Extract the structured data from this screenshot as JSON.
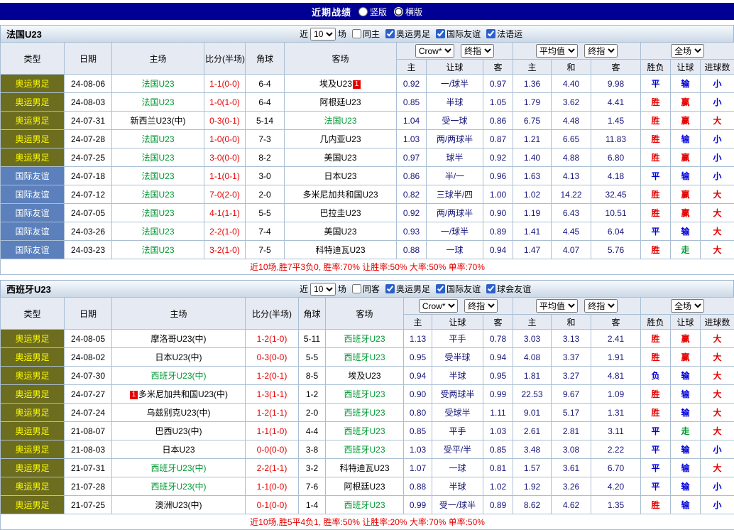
{
  "topbar": {
    "title": "近期战绩",
    "radios": [
      {
        "label": "竖版",
        "selected": false
      },
      {
        "label": "横版",
        "selected": true
      }
    ]
  },
  "table_headers": {
    "type": "类型",
    "date": "日期",
    "home": "主场",
    "score": "比分(半场)",
    "corner": "角球",
    "away": "客场",
    "sub": [
      "主",
      "让球",
      "客",
      "主",
      "和",
      "客",
      "胜负",
      "让球",
      "进球数"
    ],
    "dd_crow": "Crow*",
    "dd_final": "终指",
    "dd_avg": "平均值",
    "dd_full": "全场"
  },
  "sections": [
    {
      "team": "法国U23",
      "filter": {
        "near": "近",
        "count": "10",
        "games": "场",
        "same": "同主",
        "leagues": [
          "奥运男足",
          "国际友谊",
          "法语运"
        ]
      },
      "rows": [
        {
          "type": "奥运男足",
          "tclass": "olympic",
          "date": "24-08-06",
          "home": "法国U23",
          "hgreen": true,
          "score": "1-1(0-0)",
          "corner": "6-4",
          "away": "埃及U23",
          "abadge": "1",
          "asian": [
            "0.92",
            "一/球半",
            "0.97"
          ],
          "euro": [
            "1.36",
            "4.40",
            "9.98"
          ],
          "res": [
            [
              "平",
              "b"
            ],
            [
              "输",
              "b"
            ],
            [
              "小",
              "b"
            ]
          ]
        },
        {
          "type": "奥运男足",
          "tclass": "olympic",
          "date": "24-08-03",
          "home": "法国U23",
          "hgreen": true,
          "score": "1-0(1-0)",
          "corner": "6-4",
          "away": "阿根廷U23",
          "asian": [
            "0.85",
            "半球",
            "1.05"
          ],
          "euro": [
            "1.79",
            "3.62",
            "4.41"
          ],
          "res": [
            [
              "胜",
              "r"
            ],
            [
              "赢",
              "r"
            ],
            [
              "小",
              "b"
            ]
          ]
        },
        {
          "type": "奥运男足",
          "tclass": "olympic",
          "date": "24-07-31",
          "home": "新西兰U23(中)",
          "score": "0-3(0-1)",
          "corner": "5-14",
          "away": "法国U23",
          "agreen": true,
          "asian": [
            "1.04",
            "受一球",
            "0.86"
          ],
          "euro": [
            "6.75",
            "4.48",
            "1.45"
          ],
          "res": [
            [
              "胜",
              "r"
            ],
            [
              "赢",
              "r"
            ],
            [
              "大",
              "r"
            ]
          ]
        },
        {
          "type": "奥运男足",
          "tclass": "olympic",
          "date": "24-07-28",
          "home": "法国U23",
          "hgreen": true,
          "score": "1-0(0-0)",
          "corner": "7-3",
          "away": "几内亚U23",
          "asian": [
            "1.03",
            "两/两球半",
            "0.87"
          ],
          "euro": [
            "1.21",
            "6.65",
            "11.83"
          ],
          "res": [
            [
              "胜",
              "r"
            ],
            [
              "输",
              "b"
            ],
            [
              "小",
              "b"
            ]
          ]
        },
        {
          "type": "奥运男足",
          "tclass": "olympic",
          "date": "24-07-25",
          "home": "法国U23",
          "hgreen": true,
          "score": "3-0(0-0)",
          "corner": "8-2",
          "away": "美国U23",
          "asian": [
            "0.97",
            "球半",
            "0.92"
          ],
          "euro": [
            "1.40",
            "4.88",
            "6.80"
          ],
          "res": [
            [
              "胜",
              "r"
            ],
            [
              "赢",
              "r"
            ],
            [
              "小",
              "b"
            ]
          ]
        },
        {
          "type": "国际友谊",
          "tclass": "friendly",
          "date": "24-07-18",
          "home": "法国U23",
          "hgreen": true,
          "score": "1-1(0-1)",
          "corner": "3-0",
          "away": "日本U23",
          "asian": [
            "0.86",
            "半/一",
            "0.96"
          ],
          "euro": [
            "1.63",
            "4.13",
            "4.18"
          ],
          "res": [
            [
              "平",
              "b"
            ],
            [
              "输",
              "b"
            ],
            [
              "小",
              "b"
            ]
          ]
        },
        {
          "type": "国际友谊",
          "tclass": "friendly",
          "date": "24-07-12",
          "home": "法国U23",
          "hgreen": true,
          "score": "7-0(2-0)",
          "corner": "2-0",
          "away": "多米尼加共和国U23",
          "asian": [
            "0.82",
            "三球半/四",
            "1.00"
          ],
          "euro": [
            "1.02",
            "14.22",
            "32.45"
          ],
          "res": [
            [
              "胜",
              "r"
            ],
            [
              "赢",
              "r"
            ],
            [
              "大",
              "r"
            ]
          ]
        },
        {
          "type": "国际友谊",
          "tclass": "friendly",
          "date": "24-07-05",
          "home": "法国U23",
          "hgreen": true,
          "score": "4-1(1-1)",
          "corner": "5-5",
          "away": "巴拉圭U23",
          "asian": [
            "0.92",
            "两/两球半",
            "0.90"
          ],
          "euro": [
            "1.19",
            "6.43",
            "10.51"
          ],
          "res": [
            [
              "胜",
              "r"
            ],
            [
              "赢",
              "r"
            ],
            [
              "大",
              "r"
            ]
          ]
        },
        {
          "type": "国际友谊",
          "tclass": "friendly",
          "date": "24-03-26",
          "home": "法国U23",
          "hgreen": true,
          "score": "2-2(1-0)",
          "corner": "7-4",
          "away": "美国U23",
          "asian": [
            "0.93",
            "一/球半",
            "0.89"
          ],
          "euro": [
            "1.41",
            "4.45",
            "6.04"
          ],
          "res": [
            [
              "平",
              "b"
            ],
            [
              "输",
              "b"
            ],
            [
              "大",
              "r"
            ]
          ]
        },
        {
          "type": "国际友谊",
          "tclass": "friendly",
          "date": "24-03-23",
          "home": "法国U23",
          "hgreen": true,
          "score": "3-2(1-0)",
          "corner": "7-5",
          "away": "科特迪瓦U23",
          "asian": [
            "0.88",
            "一球",
            "0.94"
          ],
          "euro": [
            "1.47",
            "4.07",
            "5.76"
          ],
          "res": [
            [
              "胜",
              "r"
            ],
            [
              "走",
              "g"
            ],
            [
              "大",
              "r"
            ]
          ]
        }
      ],
      "footer": "近10场,胜7平3负0, 胜率:70% 让胜率:50% 大率:50% 单率:70%"
    },
    {
      "team": "西班牙U23",
      "filter": {
        "near": "近",
        "count": "10",
        "games": "场",
        "same": "同客",
        "leagues": [
          "奥运男足",
          "国际友谊",
          "球会友谊"
        ]
      },
      "rows": [
        {
          "type": "奥运男足",
          "tclass": "olympic",
          "date": "24-08-05",
          "home": "摩洛哥U23(中)",
          "score": "1-2(1-0)",
          "corner": "5-11",
          "away": "西班牙U23",
          "agreen": true,
          "asian": [
            "1.13",
            "平手",
            "0.78"
          ],
          "euro": [
            "3.03",
            "3.13",
            "2.41"
          ],
          "res": [
            [
              "胜",
              "r"
            ],
            [
              "赢",
              "r"
            ],
            [
              "大",
              "r"
            ]
          ]
        },
        {
          "type": "奥运男足",
          "tclass": "olympic",
          "date": "24-08-02",
          "home": "日本U23(中)",
          "score": "0-3(0-0)",
          "corner": "5-5",
          "away": "西班牙U23",
          "agreen": true,
          "asian": [
            "0.95",
            "受半球",
            "0.94"
          ],
          "euro": [
            "4.08",
            "3.37",
            "1.91"
          ],
          "res": [
            [
              "胜",
              "r"
            ],
            [
              "赢",
              "r"
            ],
            [
              "大",
              "r"
            ]
          ]
        },
        {
          "type": "奥运男足",
          "tclass": "olympic",
          "date": "24-07-30",
          "home": "西班牙U23(中)",
          "hgreen": true,
          "score": "1-2(0-1)",
          "corner": "8-5",
          "away": "埃及U23",
          "asian": [
            "0.94",
            "半球",
            "0.95"
          ],
          "euro": [
            "1.81",
            "3.27",
            "4.81"
          ],
          "res": [
            [
              "负",
              "b"
            ],
            [
              "输",
              "b"
            ],
            [
              "大",
              "r"
            ]
          ]
        },
        {
          "type": "奥运男足",
          "tclass": "olympic",
          "date": "24-07-27",
          "home": "多米尼加共和国U23(中)",
          "hbadge": "1",
          "score": "1-3(1-1)",
          "corner": "1-2",
          "away": "西班牙U23",
          "agreen": true,
          "asian": [
            "0.90",
            "受两球半",
            "0.99"
          ],
          "euro": [
            "22.53",
            "9.67",
            "1.09"
          ],
          "res": [
            [
              "胜",
              "r"
            ],
            [
              "输",
              "b"
            ],
            [
              "大",
              "r"
            ]
          ]
        },
        {
          "type": "奥运男足",
          "tclass": "olympic",
          "date": "24-07-24",
          "home": "乌兹别克U23(中)",
          "score": "1-2(1-1)",
          "corner": "2-0",
          "away": "西班牙U23",
          "agreen": true,
          "asian": [
            "0.80",
            "受球半",
            "1.11"
          ],
          "euro": [
            "9.01",
            "5.17",
            "1.31"
          ],
          "res": [
            [
              "胜",
              "r"
            ],
            [
              "输",
              "b"
            ],
            [
              "大",
              "r"
            ]
          ]
        },
        {
          "type": "奥运男足",
          "tclass": "olympic",
          "date": "21-08-07",
          "home": "巴西U23(中)",
          "score": "1-1(1-0)",
          "corner": "4-4",
          "away": "西班牙U23",
          "agreen": true,
          "asian": [
            "0.85",
            "平手",
            "1.03"
          ],
          "euro": [
            "2.61",
            "2.81",
            "3.11"
          ],
          "res": [
            [
              "平",
              "b"
            ],
            [
              "走",
              "g"
            ],
            [
              "大",
              "r"
            ]
          ]
        },
        {
          "type": "奥运男足",
          "tclass": "olympic",
          "date": "21-08-03",
          "home": "日本U23",
          "score": "0-0(0-0)",
          "corner": "3-8",
          "away": "西班牙U23",
          "agreen": true,
          "asian": [
            "1.03",
            "受平/半",
            "0.85"
          ],
          "euro": [
            "3.48",
            "3.08",
            "2.22"
          ],
          "res": [
            [
              "平",
              "b"
            ],
            [
              "输",
              "b"
            ],
            [
              "小",
              "b"
            ]
          ]
        },
        {
          "type": "奥运男足",
          "tclass": "olympic",
          "date": "21-07-31",
          "home": "西班牙U23(中)",
          "hgreen": true,
          "score": "2-2(1-1)",
          "corner": "3-2",
          "away": "科特迪瓦U23",
          "asian": [
            "1.07",
            "一球",
            "0.81"
          ],
          "euro": [
            "1.57",
            "3.61",
            "6.70"
          ],
          "res": [
            [
              "平",
              "b"
            ],
            [
              "输",
              "b"
            ],
            [
              "大",
              "r"
            ]
          ]
        },
        {
          "type": "奥运男足",
          "tclass": "olympic",
          "date": "21-07-28",
          "home": "西班牙U23(中)",
          "hgreen": true,
          "score": "1-1(0-0)",
          "corner": "7-6",
          "away": "阿根廷U23",
          "asian": [
            "0.88",
            "半球",
            "1.02"
          ],
          "euro": [
            "1.92",
            "3.26",
            "4.20"
          ],
          "res": [
            [
              "平",
              "b"
            ],
            [
              "输",
              "b"
            ],
            [
              "小",
              "b"
            ]
          ]
        },
        {
          "type": "奥运男足",
          "tclass": "olympic",
          "date": "21-07-25",
          "home": "澳洲U23(中)",
          "score": "0-1(0-0)",
          "corner": "1-4",
          "away": "西班牙U23",
          "agreen": true,
          "asian": [
            "0.99",
            "受一/球半",
            "0.89"
          ],
          "euro": [
            "8.62",
            "4.62",
            "1.35"
          ],
          "res": [
            [
              "胜",
              "r"
            ],
            [
              "输",
              "b"
            ],
            [
              "小",
              "b"
            ]
          ]
        }
      ],
      "footer": "近10场,胜5平4负1, 胜率:50% 让胜率:20% 大率:70% 单率:50%"
    }
  ]
}
